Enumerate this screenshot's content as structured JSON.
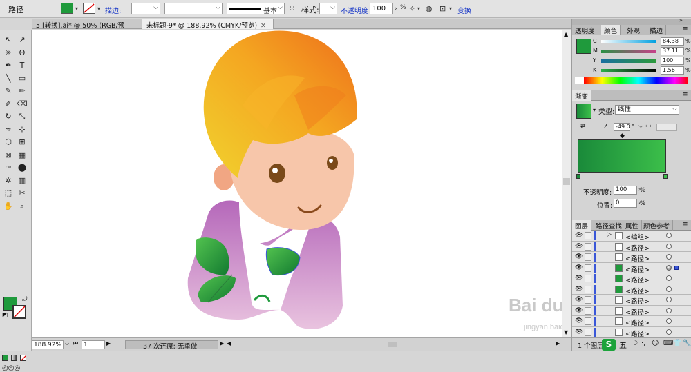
{
  "control_bar": {
    "object_type": "路径",
    "stroke_label": "描边:",
    "stroke_style": "基本",
    "style_label": "样式:",
    "opacity_label": "不透明度",
    "opacity_value": "100",
    "opacity_unit": "%",
    "transform_label": "变换",
    "fill_color": "#1f9a3c"
  },
  "document_tabs": [
    {
      "label": "5 [转换].ai* @ 50% (RGB/预览)",
      "close": "✕"
    },
    {
      "label": "未标题-9* @ 188.92% (CMYK/预览)",
      "close": "✕"
    }
  ],
  "toolbox": {
    "tools": [
      "selection-tool",
      "direct-selection-tool",
      "magic-wand-tool",
      "lasso-tool",
      "pen-tool",
      "type-tool",
      "line-tool",
      "rectangle-tool",
      "paintbrush-tool",
      "pencil-tool",
      "blob-brush-tool",
      "eraser-tool",
      "rotate-tool",
      "scale-tool",
      "warp-tool",
      "free-transform-tool",
      "shape-builder-tool",
      "perspective-grid-tool",
      "mesh-tool",
      "gradient-tool",
      "eyedropper-tool",
      "blend-tool",
      "symbol-sprayer-tool",
      "column-graph-tool",
      "artboard-tool",
      "slice-tool",
      "hand-tool",
      "zoom-tool"
    ],
    "fill_color": "#1f9a3c"
  },
  "status_bar": {
    "zoom": "188.92%",
    "page": "1",
    "message": "37 次还原; 无重做"
  },
  "color_panel": {
    "tabs": [
      "透明度",
      "颜色",
      "外观",
      "描边"
    ],
    "active_tab": "颜色",
    "swatch": "#1f9a3c",
    "channels": [
      {
        "name": "C",
        "value": "84.38",
        "bar": "linear-gradient(90deg,#fff,#00a0e0)"
      },
      {
        "name": "M",
        "value": "37.11",
        "bar": "linear-gradient(90deg,#2a8f45,#c9408a)"
      },
      {
        "name": "Y",
        "value": "100",
        "bar": "linear-gradient(90deg,#1a6fa0,#2c9a3a)"
      },
      {
        "name": "K",
        "value": "1.56",
        "bar": "linear-gradient(90deg,#2ab04a,#000)"
      }
    ],
    "unit": "%"
  },
  "gradient_panel": {
    "title": "渐变",
    "type_label": "类型:",
    "type_value": "线性",
    "angle": "-49.0",
    "angle_unit": "°",
    "opacity_label": "不透明度:",
    "opacity_value": "100",
    "location_label": "位置:",
    "location_value": "0",
    "unit": "%",
    "start_color": "#1a8a3a",
    "end_color": "#3cbf4a"
  },
  "layers_panel": {
    "tabs": [
      "图层",
      "路径查找",
      "属性",
      "颜色参考"
    ],
    "active_tab": "图层",
    "rows": [
      {
        "name": "<编组>",
        "thumb": "white",
        "selected": false
      },
      {
        "name": "<路径>",
        "thumb": "white",
        "selected": false
      },
      {
        "name": "<路径>",
        "thumb": "white",
        "selected": false
      },
      {
        "name": "<路径>",
        "thumb": "green",
        "selected": true
      },
      {
        "name": "<路径>",
        "thumb": "green",
        "selected": false
      },
      {
        "name": "<路径>",
        "thumb": "green",
        "selected": false
      },
      {
        "name": "<路径>",
        "thumb": "white",
        "selected": false
      },
      {
        "name": "<路径>",
        "thumb": "white",
        "selected": false
      },
      {
        "name": "<路径>",
        "thumb": "white",
        "selected": false
      },
      {
        "name": "<路径>",
        "thumb": "white",
        "selected": false
      }
    ],
    "footer": "1 个图层"
  },
  "watermark": {
    "brand": "Bai du 经验",
    "url": "jingyan.baidu.com"
  },
  "ime": {
    "label": "五"
  }
}
